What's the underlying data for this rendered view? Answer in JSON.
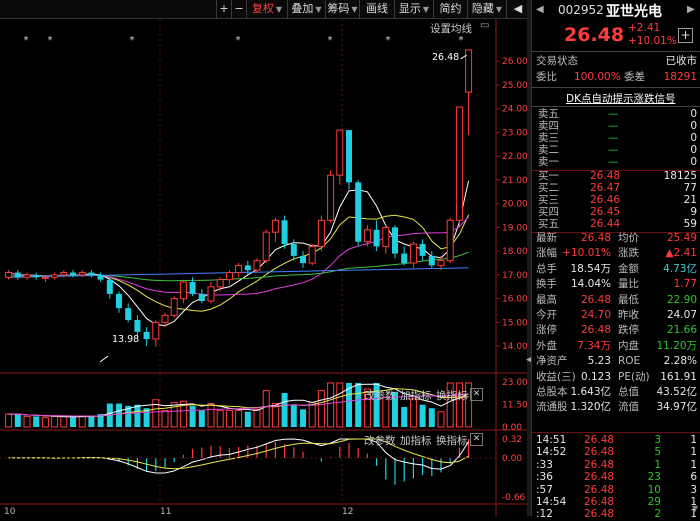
{
  "toolbar": {
    "plus": "+",
    "minus": "−",
    "fuquan": "复权",
    "diejia": "叠加",
    "chouma": "筹码",
    "huaxian": "画线",
    "xianshi": "显示",
    "jianyue": "简约",
    "yincang": "隐藏"
  },
  "chart": {
    "settings_label": "设置均线",
    "price_high_label": "26.48",
    "price_low_label": "13.98",
    "price_ticks": [
      "26.00",
      "25.00",
      "24.00",
      "23.00",
      "22.00",
      "21.00",
      "20.00",
      "19.00",
      "18.00",
      "17.00",
      "16.00",
      "15.00",
      "14.00"
    ],
    "vol_ticks": [
      "23.00",
      "11.50",
      "0.00"
    ],
    "macd_ticks": [
      "0.32",
      "0.00",
      "-0.66"
    ],
    "vol_links": [
      "改参数",
      "加指标",
      "换指标"
    ],
    "macd_links": [
      "改参数",
      "加指标",
      "换指标"
    ],
    "x_labels": [
      "10",
      "11",
      "12"
    ],
    "close_icon": "✕"
  },
  "stock": {
    "code": "002952",
    "name": "亚世光电",
    "price": "26.48",
    "change": "+2.41",
    "pct": "+10.01%",
    "status_label": "交易状态",
    "status_value": "已收市",
    "weibi_label": "委比",
    "weibi_value": "100.00%",
    "weicha_label": "委差",
    "weicha_value": "18291",
    "signal": "DK点自动提示涨跌信号"
  },
  "orderbook": {
    "asks": [
      {
        "label": "卖五",
        "price": "—",
        "vol": "0"
      },
      {
        "label": "卖四",
        "price": "—",
        "vol": "0"
      },
      {
        "label": "卖三",
        "price": "—",
        "vol": "0"
      },
      {
        "label": "卖二",
        "price": "—",
        "vol": "0"
      },
      {
        "label": "卖一",
        "price": "—",
        "vol": "0"
      }
    ],
    "bids": [
      {
        "label": "买一",
        "price": "26.48",
        "vol": "18125"
      },
      {
        "label": "买二",
        "price": "26.47",
        "vol": "77"
      },
      {
        "label": "买三",
        "price": "26.46",
        "vol": "21"
      },
      {
        "label": "买四",
        "price": "26.45",
        "vol": "9"
      },
      {
        "label": "买五",
        "price": "26.44",
        "vol": "59"
      }
    ]
  },
  "stats": [
    [
      {
        "l": "最新",
        "v": "26.48",
        "c": "red"
      },
      {
        "l": "均价",
        "v": "25.49",
        "c": "red"
      }
    ],
    [
      {
        "l": "涨幅",
        "v": "+10.01%",
        "c": "red"
      },
      {
        "l": "涨跌",
        "v": "▲2.41",
        "c": "red"
      }
    ],
    [
      {
        "l": "总手",
        "v": "18.54万",
        "c": "wht"
      },
      {
        "l": "金额",
        "v": "4.73亿",
        "c": "cyn"
      }
    ],
    [
      {
        "l": "换手",
        "v": "14.04%",
        "c": "wht"
      },
      {
        "l": "量比",
        "v": "1.77",
        "c": "red"
      }
    ],
    [
      {
        "l": "最高",
        "v": "26.48",
        "c": "red"
      },
      {
        "l": "最低",
        "v": "22.90",
        "c": "grn"
      }
    ],
    [
      {
        "l": "今开",
        "v": "24.70",
        "c": "red"
      },
      {
        "l": "昨收",
        "v": "24.07",
        "c": "wht"
      }
    ],
    [
      {
        "l": "涨停",
        "v": "26.48",
        "c": "red"
      },
      {
        "l": "跌停",
        "v": "21.66",
        "c": "grn"
      }
    ],
    [
      {
        "l": "外盘",
        "v": "7.34万",
        "c": "red"
      },
      {
        "l": "内盘",
        "v": "11.20万",
        "c": "grn"
      }
    ],
    [
      {
        "l": "净资产",
        "v": "5.23",
        "c": "wht"
      },
      {
        "l": "ROE",
        "v": "2.28%",
        "c": "wht"
      }
    ],
    [
      {
        "l": "收益(三)",
        "v": "0.123",
        "c": "wht"
      },
      {
        "l": "PE(动)",
        "v": "161.91",
        "c": "wht"
      }
    ],
    [
      {
        "l": "总股本",
        "v": "1.643亿",
        "c": "wht"
      },
      {
        "l": "总值",
        "v": "43.52亿",
        "c": "wht"
      }
    ],
    [
      {
        "l": "流通股",
        "v": "1.320亿",
        "c": "wht"
      },
      {
        "l": "流值",
        "v": "34.97亿",
        "c": "wht"
      }
    ]
  ],
  "trades": [
    {
      "time": "14:51",
      "price": "26.48",
      "vol": "3",
      "flag": "1",
      "vc": "grn"
    },
    {
      "time": "14:52",
      "price": "26.48",
      "vol": "5",
      "flag": "1",
      "vc": "grn"
    },
    {
      "time": ":33",
      "price": "26.48",
      "vol": "1",
      "flag": "1",
      "vc": "grn"
    },
    {
      "time": ":36",
      "price": "26.48",
      "vol": "23",
      "flag": "6",
      "vc": "grn"
    },
    {
      "time": ":57",
      "price": "26.48",
      "vol": "10",
      "flag": "3",
      "vc": "grn"
    },
    {
      "time": "14:54",
      "price": "26.48",
      "vol": "29",
      "flag": "1",
      "vc": "grn"
    },
    {
      "time": ":12",
      "price": "26.48",
      "vol": "2",
      "flag": "1",
      "vc": "grn"
    }
  ],
  "chart_data": {
    "type": "candlestick",
    "price_ylim": [
      13.5,
      26.6
    ],
    "candles": [
      [
        16.9,
        17.1,
        17.2,
        16.8
      ],
      [
        17.1,
        16.9,
        17.2,
        16.8
      ],
      [
        16.9,
        17.0,
        17.1,
        16.8
      ],
      [
        17.0,
        16.9,
        17.1,
        16.8
      ],
      [
        16.9,
        16.9,
        17.0,
        16.7
      ],
      [
        16.9,
        17.0,
        17.1,
        16.8
      ],
      [
        17.0,
        17.1,
        17.2,
        16.9
      ],
      [
        17.1,
        17.0,
        17.2,
        16.9
      ],
      [
        17.0,
        17.1,
        17.2,
        16.9
      ],
      [
        17.1,
        17.0,
        17.2,
        16.9
      ],
      [
        17.0,
        16.8,
        17.1,
        16.7
      ],
      [
        16.8,
        16.2,
        16.9,
        16.0
      ],
      [
        16.2,
        15.6,
        16.3,
        15.4
      ],
      [
        15.6,
        15.1,
        15.8,
        15.0
      ],
      [
        15.1,
        14.6,
        15.3,
        14.4
      ],
      [
        14.6,
        14.3,
        14.8,
        14.0
      ],
      [
        14.3,
        15.0,
        15.1,
        13.98
      ],
      [
        15.0,
        15.3,
        15.4,
        14.8
      ],
      [
        15.3,
        16.0,
        16.1,
        15.2
      ],
      [
        16.0,
        16.7,
        16.8,
        15.8
      ],
      [
        16.7,
        16.2,
        16.9,
        16.1
      ],
      [
        16.2,
        15.9,
        16.4,
        15.8
      ],
      [
        15.9,
        16.5,
        16.7,
        15.8
      ],
      [
        16.5,
        16.8,
        16.9,
        16.3
      ],
      [
        16.8,
        17.1,
        17.2,
        16.6
      ],
      [
        17.1,
        17.4,
        17.5,
        16.9
      ],
      [
        17.4,
        17.2,
        17.6,
        17.0
      ],
      [
        17.2,
        17.6,
        17.7,
        17.1
      ],
      [
        17.6,
        18.8,
        18.9,
        17.5
      ],
      [
        18.8,
        19.3,
        19.4,
        18.4
      ],
      [
        19.3,
        18.3,
        19.5,
        18.1
      ],
      [
        18.3,
        17.8,
        18.5,
        17.6
      ],
      [
        17.8,
        17.5,
        18.0,
        17.3
      ],
      [
        17.5,
        18.2,
        18.3,
        17.4
      ],
      [
        18.2,
        19.3,
        19.5,
        18.0
      ],
      [
        19.3,
        21.2,
        21.4,
        19.2
      ],
      [
        21.2,
        23.1,
        23.1,
        20.8
      ],
      [
        23.1,
        20.9,
        23.1,
        20.6
      ],
      [
        20.9,
        18.4,
        21.0,
        18.2
      ],
      [
        18.4,
        18.9,
        19.1,
        18.2
      ],
      [
        18.9,
        18.2,
        19.3,
        18.0
      ],
      [
        18.2,
        19.0,
        19.1,
        17.9
      ],
      [
        19.0,
        17.9,
        19.1,
        17.7
      ],
      [
        17.9,
        17.5,
        18.2,
        17.4
      ],
      [
        17.5,
        18.3,
        18.4,
        17.3
      ],
      [
        18.3,
        17.8,
        18.5,
        17.6
      ],
      [
        17.8,
        17.4,
        18.0,
        17.3
      ],
      [
        17.4,
        17.6,
        17.8,
        17.2
      ],
      [
        17.6,
        19.3,
        19.4,
        17.5
      ],
      [
        19.3,
        24.07,
        24.1,
        19.0
      ],
      [
        24.7,
        26.48,
        26.48,
        22.9
      ]
    ],
    "ma": [
      {
        "name": "MA5",
        "color": "#ffffff"
      },
      {
        "name": "MA10",
        "color": "#e8e84c"
      },
      {
        "name": "MA20",
        "color": "#e040e0"
      },
      {
        "name": "MA30",
        "color": "#40c040"
      },
      {
        "name": "MA60",
        "color": "#4080ff"
      }
    ],
    "volume_ylim": [
      0,
      23
    ],
    "macd_ylim": [
      -0.66,
      0.32
    ]
  }
}
